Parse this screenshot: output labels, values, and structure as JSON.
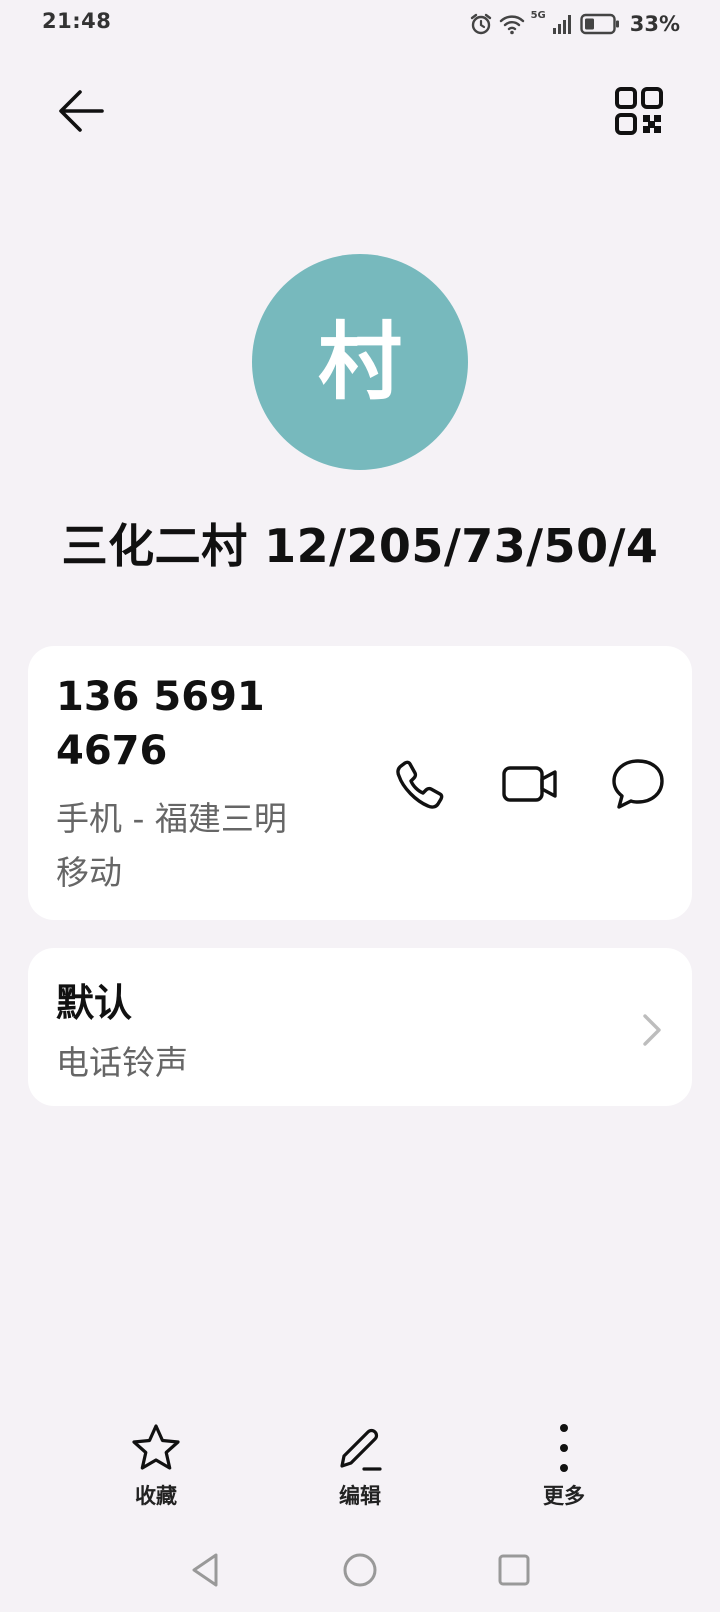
{
  "status_bar": {
    "time": "21:48",
    "network": "5G",
    "battery": "33%",
    "icons": [
      "alarm-icon",
      "wifi-icon",
      "signal-icon",
      "battery-icon"
    ]
  },
  "header": {
    "back_icon": "arrow-left-icon",
    "qr_icon": "qr-code-icon"
  },
  "contact": {
    "avatar_char": "村",
    "avatar_color": "#77b9bd",
    "name": "三化二村 12/205/73/50/4"
  },
  "phone_card": {
    "number_line1": "136 5691",
    "number_line2": "4676",
    "label_line1": "手机 - 福建三明",
    "label_line2": "移动",
    "actions": [
      "phone-icon",
      "video-call-icon",
      "message-icon"
    ]
  },
  "ringtone_card": {
    "title": "默认",
    "subtitle": "电话铃声"
  },
  "bottom_actions": [
    {
      "label": "收藏",
      "icon": "star-icon"
    },
    {
      "label": "编辑",
      "icon": "pencil-icon"
    },
    {
      "label": "更多",
      "icon": "more-vertical-icon"
    }
  ],
  "nav_bar": [
    "back-triangle-icon",
    "home-circle-icon",
    "recents-square-icon"
  ]
}
